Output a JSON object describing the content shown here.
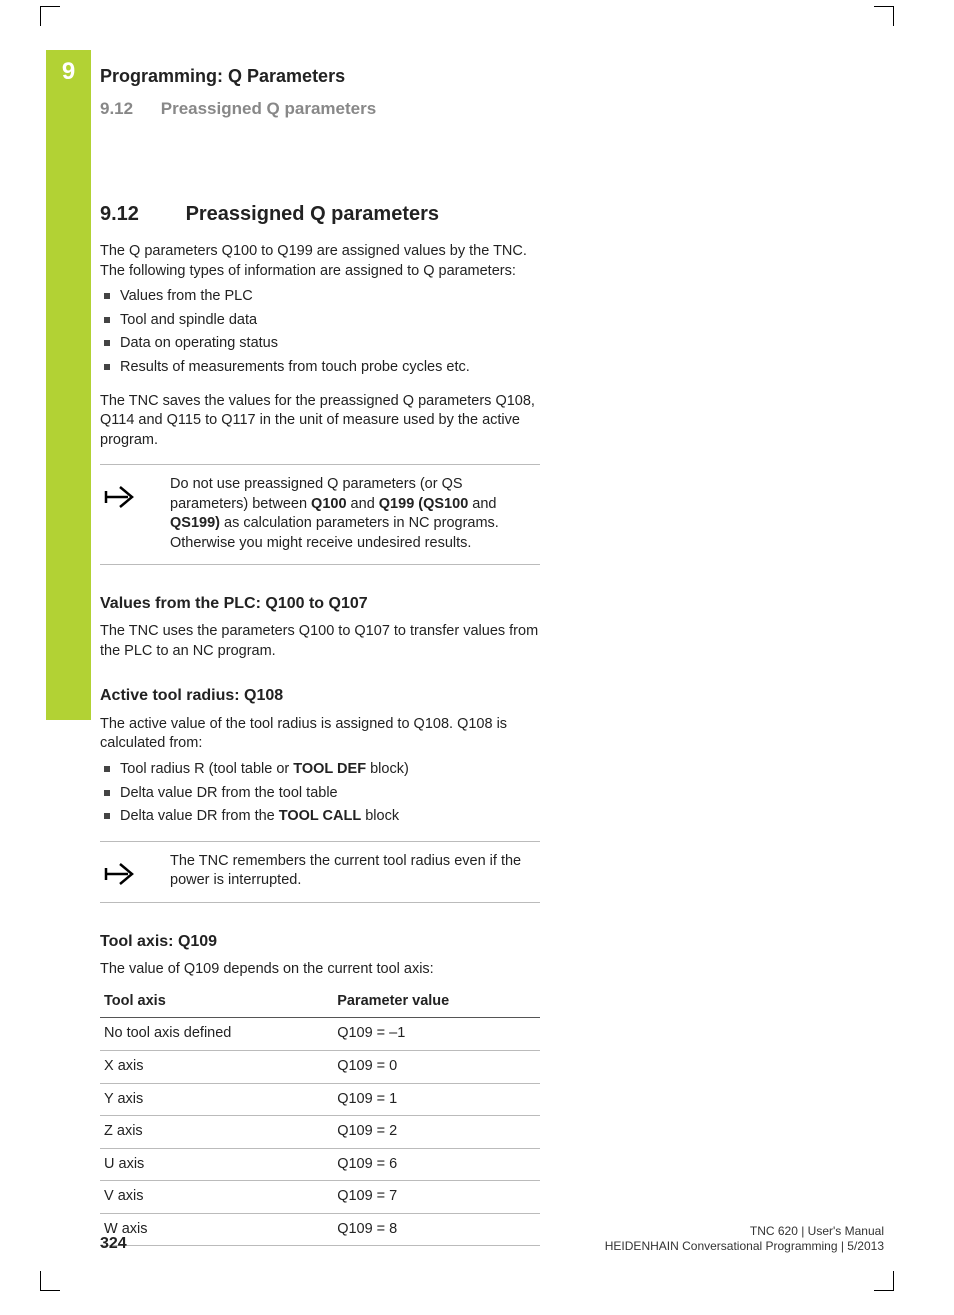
{
  "chapter_number": "9",
  "running_head": "Programming: Q Parameters",
  "running_sub_num": "9.12",
  "running_sub_title": "Preassigned Q parameters",
  "section_num": "9.12",
  "section_title": "Preassigned Q parameters",
  "intro_p1": "The Q parameters Q100 to Q199 are assigned values by the TNC. The following types of information are assigned to Q parameters:",
  "intro_list": [
    "Values from the PLC",
    "Tool and spindle data",
    "Data on operating status",
    "Results of measurements from touch probe cycles etc."
  ],
  "intro_p2": "The TNC saves the values for the preassigned Q parameters Q108, Q114 and Q115 to Q117 in the unit of measure used by the active program.",
  "note1_pre": "Do not use preassigned Q parameters (or QS parameters) between ",
  "note1_b1": "Q100",
  "note1_mid1": " and ",
  "note1_b2": "Q199 (QS100",
  "note1_mid2": " and ",
  "note1_b3": "QS199)",
  "note1_post": " as calculation parameters in NC programs. Otherwise you might receive undesired results.",
  "plc_heading": "Values from the PLC: Q100 to Q107",
  "plc_body": "The TNC uses the parameters Q100 to Q107 to transfer values from the PLC to an NC program.",
  "q108_heading": "Active tool radius: Q108",
  "q108_body": "The active value of the tool radius is assigned to Q108. Q108 is calculated from:",
  "q108_li1_pre": "Tool radius R (tool table or ",
  "q108_li1_b": "TOOL DEF",
  "q108_li1_post": " block)",
  "q108_li2": "Delta value DR from the tool table",
  "q108_li3_pre": "Delta value DR from the ",
  "q108_li3_b": "TOOL CALL",
  "q108_li3_post": " block",
  "note2": "The TNC remembers the current tool radius even if the power is interrupted.",
  "q109_heading": "Tool axis: Q109",
  "q109_body": "The value of Q109 depends on the current tool axis:",
  "table": {
    "h1": "Tool axis",
    "h2": "Parameter value",
    "rows": [
      {
        "a": "No tool axis defined",
        "b": "Q109 = –1"
      },
      {
        "a": "X axis",
        "b": "Q109 = 0"
      },
      {
        "a": "Y axis",
        "b": "Q109 = 1"
      },
      {
        "a": "Z axis",
        "b": "Q109 = 2"
      },
      {
        "a": "U axis",
        "b": "Q109 = 6"
      },
      {
        "a": "V axis",
        "b": "Q109 = 7"
      },
      {
        "a": "W axis",
        "b": "Q109 = 8"
      }
    ]
  },
  "page_number": "324",
  "footer_line1": "TNC 620 | User's Manual",
  "footer_line2": "HEIDENHAIN Conversational Programming | 5/2013"
}
